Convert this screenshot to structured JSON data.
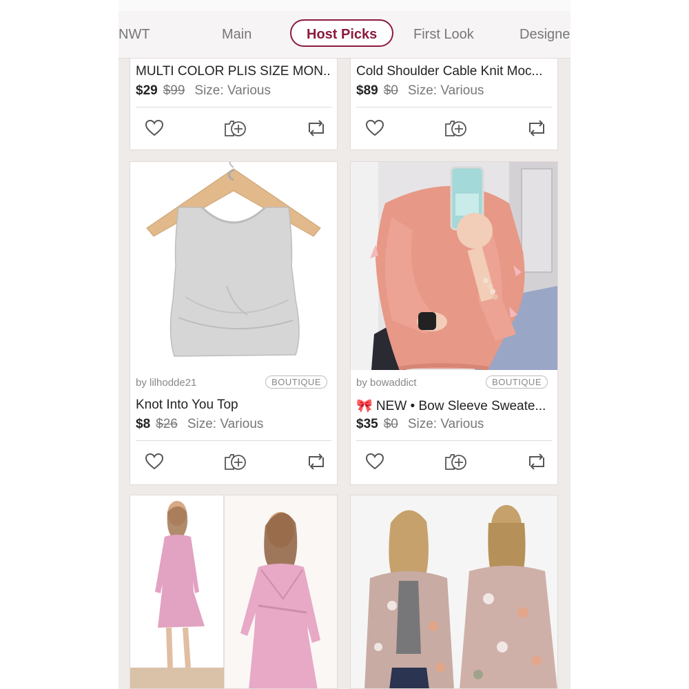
{
  "tabs": [
    {
      "label": "NWT"
    },
    {
      "label": "Main"
    },
    {
      "label": "Host Picks"
    },
    {
      "label": "First Look"
    },
    {
      "label": "Designe"
    }
  ],
  "icons": {
    "like": "heart-icon",
    "add_to_bundle": "add-to-bundle-icon",
    "share": "share-icon"
  },
  "colors": {
    "accent": "#8b1a3c",
    "background": "#efebe9"
  },
  "listings": [
    {
      "seller": "",
      "badge": "",
      "title": "MULTI COLOR PLIS SIZE MON...",
      "price": "$29",
      "original_price": "$99",
      "size_label": "Size:",
      "size_value": "Various"
    },
    {
      "seller": "",
      "badge": "",
      "title": "Cold Shoulder Cable Knit Moc...",
      "price": "$89",
      "original_price": "$0",
      "size_label": "Size:",
      "size_value": "Various"
    },
    {
      "seller": "by lilhodde21",
      "badge": "BOUTIQUE",
      "title": "Knot Into You Top",
      "price": "$8",
      "original_price": "$26",
      "size_label": "Size:",
      "size_value": "Various"
    },
    {
      "seller": "by bowaddict",
      "badge": "BOUTIQUE",
      "title": "🎀 NEW • Bow Sleeve Sweate...",
      "price": "$35",
      "original_price": "$0",
      "size_label": "Size:",
      "size_value": "Various"
    },
    {
      "seller": "",
      "badge": "",
      "title": "",
      "price": "",
      "original_price": "",
      "size_label": "",
      "size_value": ""
    },
    {
      "seller": "",
      "badge": "",
      "title": "",
      "price": "",
      "original_price": "",
      "size_label": "",
      "size_value": ""
    }
  ]
}
